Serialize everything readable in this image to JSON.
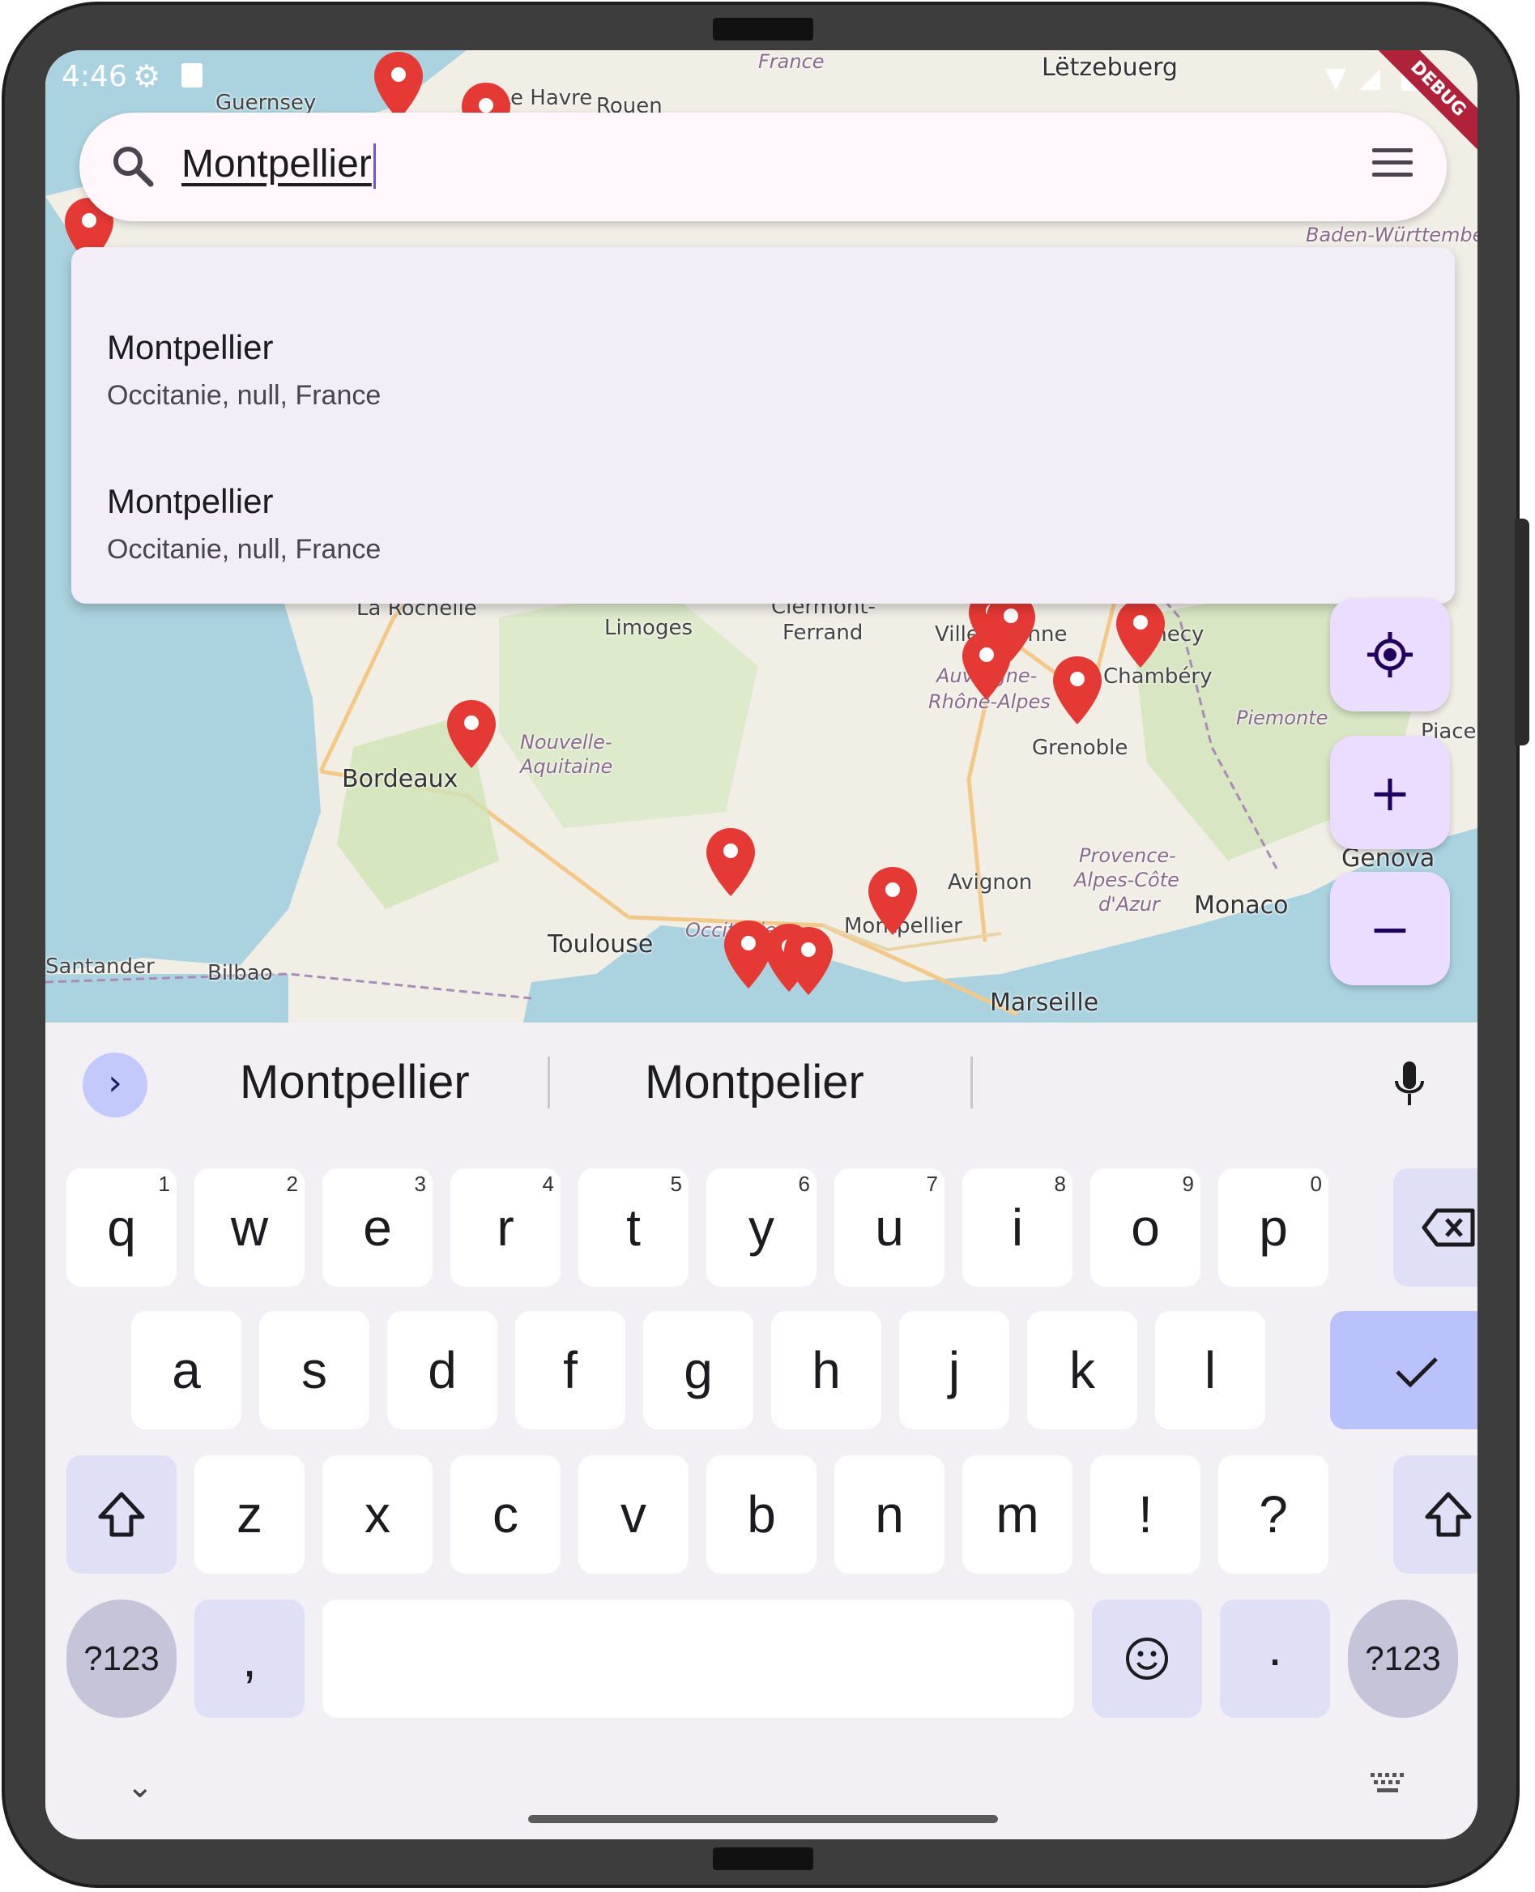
{
  "status_bar": {
    "time": "4:46",
    "debug_banner": "DEBUG"
  },
  "search": {
    "query": "Montpellier"
  },
  "suggestions": [
    {
      "title": "Montpellier",
      "subtitle": "Occitanie, null, France"
    },
    {
      "title": "Montpellier",
      "subtitle": "Occitanie, null, France"
    }
  ],
  "map_labels": {
    "france": "France",
    "letzeburg": "Lëtzebuerg",
    "guernsey": "Guernsey",
    "le_havre": "Le Havre",
    "rouen": "Rouen",
    "baden": "Baden-Württemberg",
    "la_rochelle": "La Rochelle",
    "limoges": "Limoges",
    "clermont1": "Clermont-",
    "clermont2": "Ferrand",
    "villeurbanne": "Villeurbanne",
    "annecy": "Annecy",
    "auvergne1": "Auvergne-",
    "auvergne2": "Rhône-Alpes",
    "chambery": "Chambéry",
    "piemonte": "Piemonte",
    "piacenza": "Piacenza",
    "bordeaux": "Bordeaux",
    "nouvelle1": "Nouvelle-",
    "nouvelle2": "Aquitaine",
    "grenoble": "Grenoble",
    "genova": "Genova",
    "provence1": "Provence-",
    "provence2": "Alpes-Côte",
    "provence3": "d'Azur",
    "avignon": "Avignon",
    "monaco": "Monaco",
    "toulouse": "Toulouse",
    "occitanie": "Occitanie",
    "montpellier": "Montpellier",
    "santander": "Santander",
    "bilbao": "Bilbao",
    "marseille": "Marseille"
  },
  "fab": {
    "locate_icon": "target-icon",
    "zoom_in": "+",
    "zoom_out": "−"
  },
  "keyboard": {
    "suggestions": [
      "Montpellier",
      "Montpelier"
    ],
    "row1": [
      {
        "k": "q",
        "n": "1"
      },
      {
        "k": "w",
        "n": "2"
      },
      {
        "k": "e",
        "n": "3"
      },
      {
        "k": "r",
        "n": "4"
      },
      {
        "k": "t",
        "n": "5"
      },
      {
        "k": "y",
        "n": "6"
      },
      {
        "k": "u",
        "n": "7"
      },
      {
        "k": "i",
        "n": "8"
      },
      {
        "k": "o",
        "n": "9"
      },
      {
        "k": "p",
        "n": "0"
      }
    ],
    "row2": [
      "a",
      "s",
      "d",
      "f",
      "g",
      "h",
      "j",
      "k",
      "l"
    ],
    "row3": [
      "z",
      "x",
      "c",
      "v",
      "b",
      "n",
      "m",
      "!",
      "?"
    ],
    "symbols_label": "?123",
    "comma": ",",
    "period": "·"
  },
  "colors": {
    "pin": "#e53935",
    "fab_bg": "#eaddff",
    "search_bg": "#fff7fb",
    "suggestion_bg": "#f3edf7"
  }
}
